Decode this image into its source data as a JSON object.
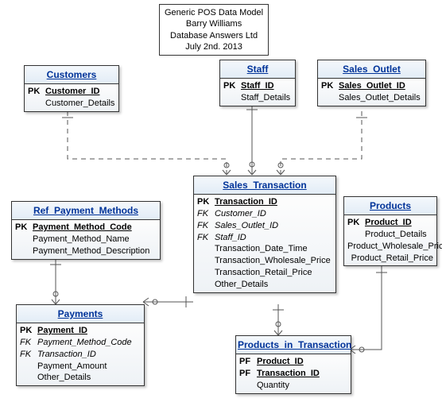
{
  "title_box": {
    "line1": "Generic POS Data Model",
    "line2": "Barry Williams",
    "line3": "Database Answers Ltd",
    "line4": "July 2nd. 2013"
  },
  "entities": {
    "customers": {
      "name": "Customers",
      "rows": [
        {
          "key": "PK",
          "attr": "Customer_ID",
          "pk": true
        },
        {
          "key": "",
          "attr": "Customer_Details"
        }
      ]
    },
    "staff": {
      "name": "Staff",
      "rows": [
        {
          "key": "PK",
          "attr": "Staff_ID",
          "pk": true
        },
        {
          "key": "",
          "attr": "Staff_Details"
        }
      ]
    },
    "sales_outlet": {
      "name": "Sales_Outlet",
      "rows": [
        {
          "key": "PK",
          "attr": "Sales_Outlet_ID",
          "pk": true
        },
        {
          "key": "",
          "attr": "Sales_Outlet_Details"
        }
      ]
    },
    "ref_payment_methods": {
      "name": "Ref_Payment_Methods",
      "rows": [
        {
          "key": "PK",
          "attr": "Payment_Method_Code",
          "pk": true
        },
        {
          "key": "",
          "attr": "Payment_Method_Name"
        },
        {
          "key": "",
          "attr": "Payment_Method_Description"
        }
      ]
    },
    "sales_transaction": {
      "name": "Sales_Transaction",
      "rows": [
        {
          "key": "PK",
          "attr": "Transaction_ID",
          "pk": true
        },
        {
          "key": "FK",
          "attr": "Customer_ID",
          "fk": true
        },
        {
          "key": "FK",
          "attr": "Sales_Outlet_ID",
          "fk": true
        },
        {
          "key": "FK",
          "attr": "Staff_ID",
          "fk": true
        },
        {
          "key": "",
          "attr": "Transaction_Date_Time"
        },
        {
          "key": "",
          "attr": "Transaction_Wholesale_Price"
        },
        {
          "key": "",
          "attr": "Transaction_Retail_Price"
        },
        {
          "key": "",
          "attr": "Other_Details"
        }
      ]
    },
    "products": {
      "name": "Products",
      "rows": [
        {
          "key": "PK",
          "attr": "Product_ID",
          "pk": true
        },
        {
          "key": "",
          "attr": "Product_Details"
        },
        {
          "key": "",
          "attr": "Product_Wholesale_Price"
        },
        {
          "key": "",
          "attr": "Product_Retail_Price"
        }
      ]
    },
    "payments": {
      "name": "Payments",
      "rows": [
        {
          "key": "PK",
          "attr": "Payment_ID",
          "pk": true
        },
        {
          "key": "FK",
          "attr": "Payment_Method_Code",
          "fk": true
        },
        {
          "key": "FK",
          "attr": "Transaction_ID",
          "fk": true
        },
        {
          "key": "",
          "attr": "Payment_Amount"
        },
        {
          "key": "",
          "attr": "Other_Details"
        }
      ]
    },
    "products_in_transaction": {
      "name": "Products_in_Transaction",
      "rows": [
        {
          "key": "PF",
          "attr": "Product_ID",
          "pk": true
        },
        {
          "key": "PF",
          "attr": "Transaction_ID",
          "pk": true
        },
        {
          "key": "",
          "attr": "Quantity"
        }
      ]
    }
  }
}
